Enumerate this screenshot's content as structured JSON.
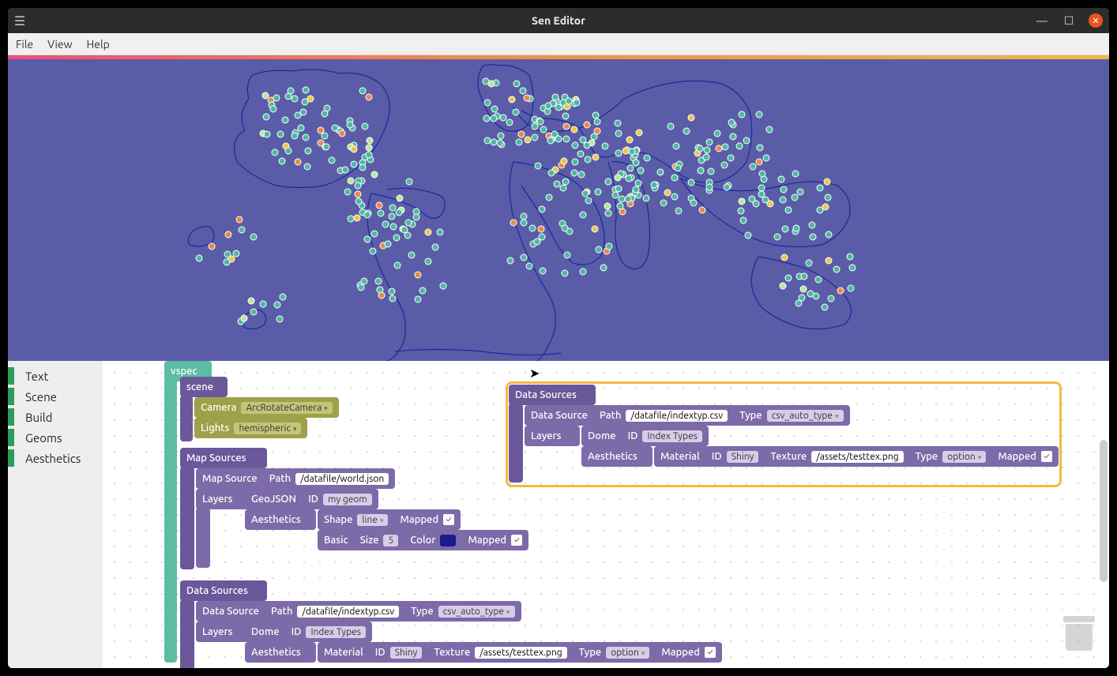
{
  "window": {
    "title": "Sen Editor"
  },
  "menu": {
    "file": "File",
    "view": "View",
    "help": "Help"
  },
  "toolbox": [
    "Text",
    "Scene",
    "Build",
    "Geoms",
    "Aesthetics"
  ],
  "blocks": {
    "vspec": "vspec",
    "scene": "scene",
    "camera_lbl": "Camera",
    "camera_val": "ArcRotateCamera",
    "lights_lbl": "Lights",
    "lights_val": "hemispheric",
    "mapsources": "Map Sources",
    "mapsource": "Map Source",
    "path_lbl": "Path",
    "mapsource_path": "/datafile/world.json",
    "layers": "Layers",
    "geojson": "GeoJSON",
    "id_lbl": "ID",
    "geojson_id": "my geom",
    "aesthetics": "Aesthetics",
    "shape_lbl": "Shape",
    "shape_val": "line",
    "mapped_lbl": "Mapped",
    "basic_lbl": "Basic",
    "size_lbl": "Size",
    "size_val": "5",
    "color_lbl": "Color",
    "datasources": "Data Sources",
    "datasource": "Data Source",
    "datasource_path": "/datafile/indextyp.csv",
    "type_lbl": "Type",
    "datasource_type": "csv_auto_type",
    "dome_lbl": "Dome",
    "dome_id": "Index Types",
    "material_lbl": "Material",
    "material_id": "Shiny",
    "texture_lbl": "Texture",
    "texture_val": "/assets/testtex.png",
    "texture_type": "option"
  },
  "colors": {
    "viewport_bg": "#5a5ca8",
    "land_stroke": "#1a2a9a",
    "dot_teal": "#4fb8a0",
    "dot_yellow": "#e8c84a",
    "dot_orange": "#e88a4a",
    "dot_lime": "#b8e89a"
  }
}
